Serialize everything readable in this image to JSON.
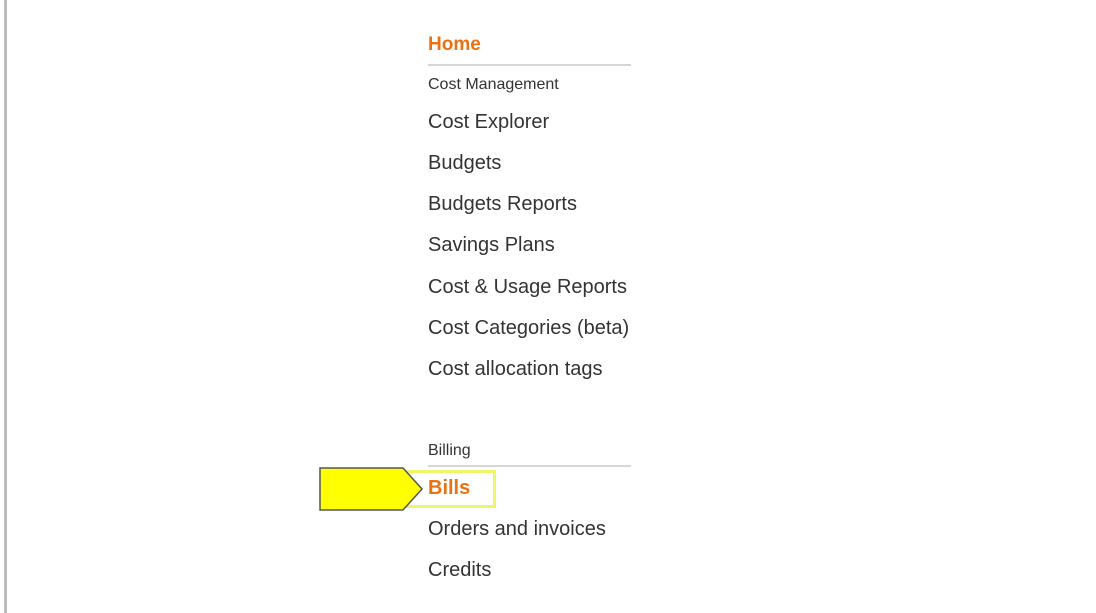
{
  "nav": {
    "home_label": "Home",
    "sections": [
      {
        "label": "Cost Management",
        "items": [
          {
            "label": "Cost Explorer"
          },
          {
            "label": "Budgets"
          },
          {
            "label": "Budgets Reports"
          },
          {
            "label": "Savings Plans"
          },
          {
            "label": "Cost & Usage Reports"
          },
          {
            "label": "Cost Categories (beta)"
          },
          {
            "label": "Cost allocation tags"
          }
        ]
      },
      {
        "label": "Billing",
        "items": [
          {
            "label": "Bills",
            "active": true
          },
          {
            "label": "Orders and invoices"
          },
          {
            "label": "Credits"
          }
        ]
      }
    ]
  },
  "colors": {
    "accent": "#ec7211",
    "text": "#333333",
    "highlight": "#ffff00",
    "highlight_border": "#eef56a"
  },
  "annotation": {
    "arrow_icon": "yellow-arrow-pointer-icon",
    "highlight_target": "Bills"
  }
}
